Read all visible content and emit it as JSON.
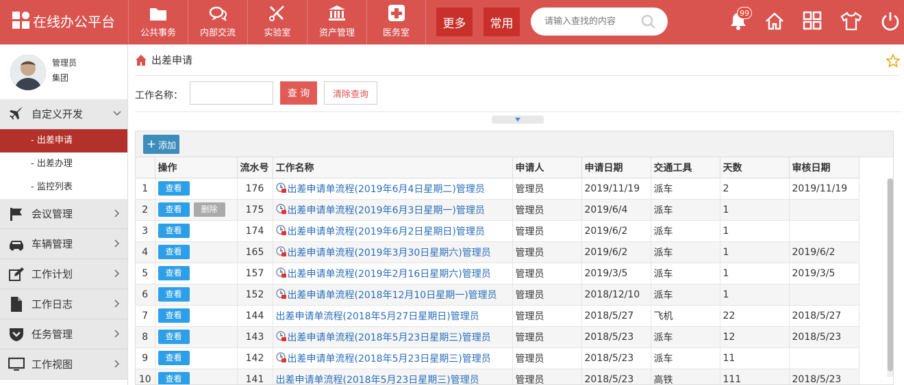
{
  "app": {
    "title": "在线办公平台"
  },
  "nav": [
    {
      "label": "公共事务",
      "icon": "folder-icon"
    },
    {
      "label": "内部交流",
      "icon": "chat-icon"
    },
    {
      "label": "实验室",
      "icon": "tools-icon"
    },
    {
      "label": "资产管理",
      "icon": "bank-icon"
    },
    {
      "label": "医务室",
      "icon": "medical-cross-icon"
    }
  ],
  "more_label": "更多",
  "common_label": "常用",
  "search": {
    "placeholder": "请输入查找的内容"
  },
  "notifications": {
    "count": "99"
  },
  "user": {
    "name": "管理员",
    "org": "集团"
  },
  "sidebar": {
    "groups": [
      {
        "label": "自定义开发",
        "icon": "airplane-icon",
        "expanded": true,
        "items": [
          {
            "label": "- 出差申请",
            "active": true
          },
          {
            "label": "- 出差办理"
          },
          {
            "label": "- 监控列表"
          }
        ]
      },
      {
        "label": "会议管理",
        "icon": "flag-icon"
      },
      {
        "label": "车辆管理",
        "icon": "car-icon"
      },
      {
        "label": "工作计划",
        "icon": "edit-icon"
      },
      {
        "label": "工作日志",
        "icon": "file-icon"
      },
      {
        "label": "任务管理",
        "icon": "shield-icon"
      },
      {
        "label": "工作视图",
        "icon": "monitor-icon"
      }
    ]
  },
  "page": {
    "title": "出差申请"
  },
  "query": {
    "label": "工作名称：",
    "value": "",
    "search_label": "查 询",
    "clear_label": "清除查询"
  },
  "toolbar": {
    "add_label": "添加"
  },
  "table": {
    "columns": [
      "",
      "操作",
      "流水号",
      "工作名称",
      "申请人",
      "申请日期",
      "交通工具",
      "天数",
      "审核日期"
    ],
    "view_label": "查看",
    "delete_label": "删除",
    "rows": [
      {
        "idx": "1",
        "sn": "176",
        "name": "出差申请单流程(2019年6月4日星期二)管理员",
        "applicant": "管理员",
        "date": "2019/11/19",
        "vehicle": "派车",
        "days": "2",
        "review": "2019/11/19",
        "icon": true,
        "del": false
      },
      {
        "idx": "2",
        "sn": "175",
        "name": "出差申请单流程(2019年6月3日星期一)管理员",
        "applicant": "管理员",
        "date": "2019/6/4",
        "vehicle": "派车",
        "days": "1",
        "review": "",
        "icon": true,
        "del": true
      },
      {
        "idx": "3",
        "sn": "174",
        "name": "出差申请单流程(2019年6月2日星期日)管理员",
        "applicant": "管理员",
        "date": "2019/6/2",
        "vehicle": "派车",
        "days": "1",
        "review": "",
        "icon": true,
        "del": false
      },
      {
        "idx": "4",
        "sn": "165",
        "name": "出差申请单流程(2019年3月30日星期六)管理员",
        "applicant": "管理员",
        "date": "2019/6/2",
        "vehicle": "派车",
        "days": "1",
        "review": "2019/6/2",
        "icon": true,
        "del": false
      },
      {
        "idx": "5",
        "sn": "157",
        "name": "出差申请单流程(2019年2月16日星期六)管理员",
        "applicant": "管理员",
        "date": "2019/3/5",
        "vehicle": "派车",
        "days": "1",
        "review": "2019/3/5",
        "icon": true,
        "del": false
      },
      {
        "idx": "6",
        "sn": "152",
        "name": "出差申请单流程(2018年12月10日星期一)管理员",
        "applicant": "管理员",
        "date": "2018/12/10",
        "vehicle": "派车",
        "days": "1",
        "review": "",
        "icon": true,
        "del": false
      },
      {
        "idx": "7",
        "sn": "144",
        "name": "出差申请单流程(2018年5月27日星期日)管理员",
        "applicant": "管理员",
        "date": "2018/5/27",
        "vehicle": "飞机",
        "days": "22",
        "review": "2018/5/27",
        "icon": false,
        "del": false
      },
      {
        "idx": "8",
        "sn": "143",
        "name": "出差申请单流程(2018年5月23日星期三)管理员",
        "applicant": "管理员",
        "date": "2018/5/23",
        "vehicle": "派车",
        "days": "12",
        "review": "2018/5/23",
        "icon": true,
        "del": false
      },
      {
        "idx": "9",
        "sn": "142",
        "name": "出差申请单流程(2018年5月23日星期三)管理员",
        "applicant": "管理员",
        "date": "2018/5/23",
        "vehicle": "派车",
        "days": "11",
        "review": "",
        "icon": true,
        "del": false
      },
      {
        "idx": "10",
        "sn": "141",
        "name": "出差申请单流程(2018年5月23日星期三)管理员",
        "applicant": "管理员",
        "date": "2018/5/23",
        "vehicle": "高铁",
        "days": "111",
        "review": "2018/5/23",
        "icon": false,
        "del": false
      }
    ]
  },
  "colors": {
    "brand": "#d9534f",
    "sidebar_active": "#b3312b",
    "view_button": "#2d9fe8",
    "link": "#2a6ebb"
  }
}
